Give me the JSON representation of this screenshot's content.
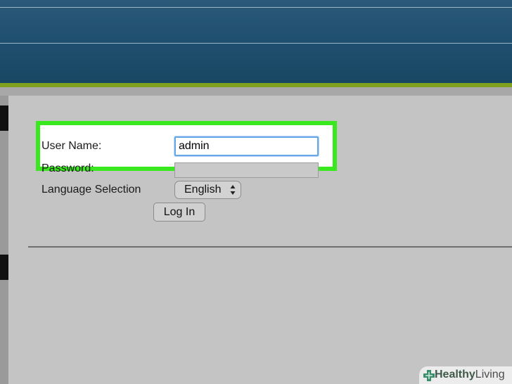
{
  "form": {
    "username_label": "User Name:",
    "username_value": "admin",
    "password_label": "Password:",
    "password_value": "",
    "language_label": "Language Selection",
    "language_selected": "English",
    "login_button": "Log In"
  },
  "watermark": {
    "part1": "Healthy",
    "part2": "Living"
  },
  "colors": {
    "header": "#1f4f6e",
    "accent": "#7fa11e",
    "highlight": "#39e81e",
    "panel": "#c4c4c4"
  }
}
